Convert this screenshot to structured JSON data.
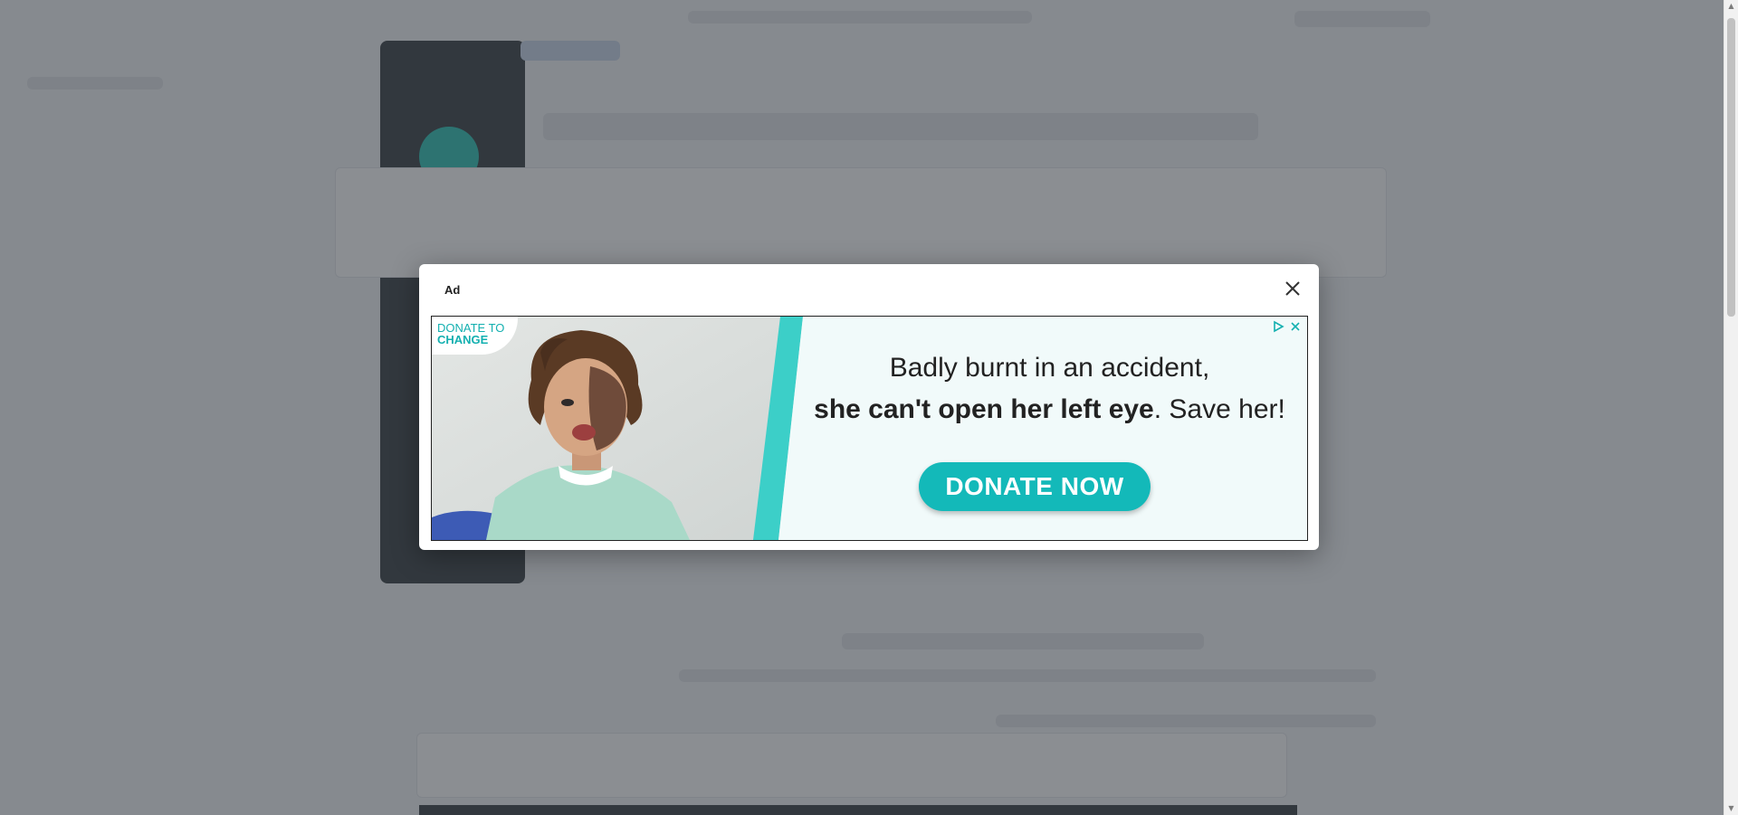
{
  "modal": {
    "label": "Ad",
    "close_icon": "close-icon"
  },
  "ad": {
    "logo_line1": "DONATE TO",
    "logo_line2": "CHANGE",
    "headline_line1": "Badly burnt in an accident,",
    "headline_bold": "she can't open her left eye",
    "headline_rest": ". Save her!",
    "cta_label": "DONATE NOW",
    "adchoices_icon": "adchoices-icon",
    "ad_close_icon": "close-icon"
  },
  "colors": {
    "accent": "#13b9b9",
    "overlay": "#373c44",
    "ad_background": "#f1fafa"
  }
}
